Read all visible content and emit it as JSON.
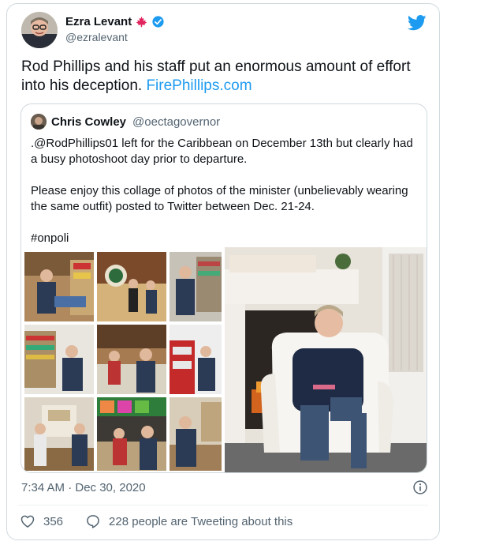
{
  "author": {
    "display_name": "Ezra Levant",
    "handle": "@ezralevant",
    "verified": true
  },
  "tweet": {
    "text": "Rod Phillips and his staff put an enormous amount of effort into his deception. ",
    "link": "FirePhillips.com",
    "timestamp": "7:34 AM · Dec 30, 2020"
  },
  "quote": {
    "display_name": "Chris Cowley",
    "handle": "@oectagovernor",
    "paragraphs": [
      ".@RodPhillips01 left for the Caribbean on December 13th but clearly had a busy photoshoot day prior to departure.",
      "Please enjoy this collage of photos of the minister (unbelievably wearing the same outfit) posted to Twitter between Dec. 21-24.",
      "#onpoli"
    ]
  },
  "actions": {
    "likes": "356",
    "conversation": "228 people are Tweeting about this"
  },
  "colors": {
    "link": "#1d9bf0",
    "secondary_text": "#536471",
    "border": "#cfd9de",
    "twitter_blue": "#1d9bf0",
    "canada_red": "#e0245e"
  },
  "icons": {
    "brand": "twitter-bird-icon",
    "verified": "verified-badge-icon",
    "flag": "maple-leaf-icon",
    "info": "info-icon",
    "like": "heart-icon",
    "reply": "reply-bubble-icon"
  }
}
